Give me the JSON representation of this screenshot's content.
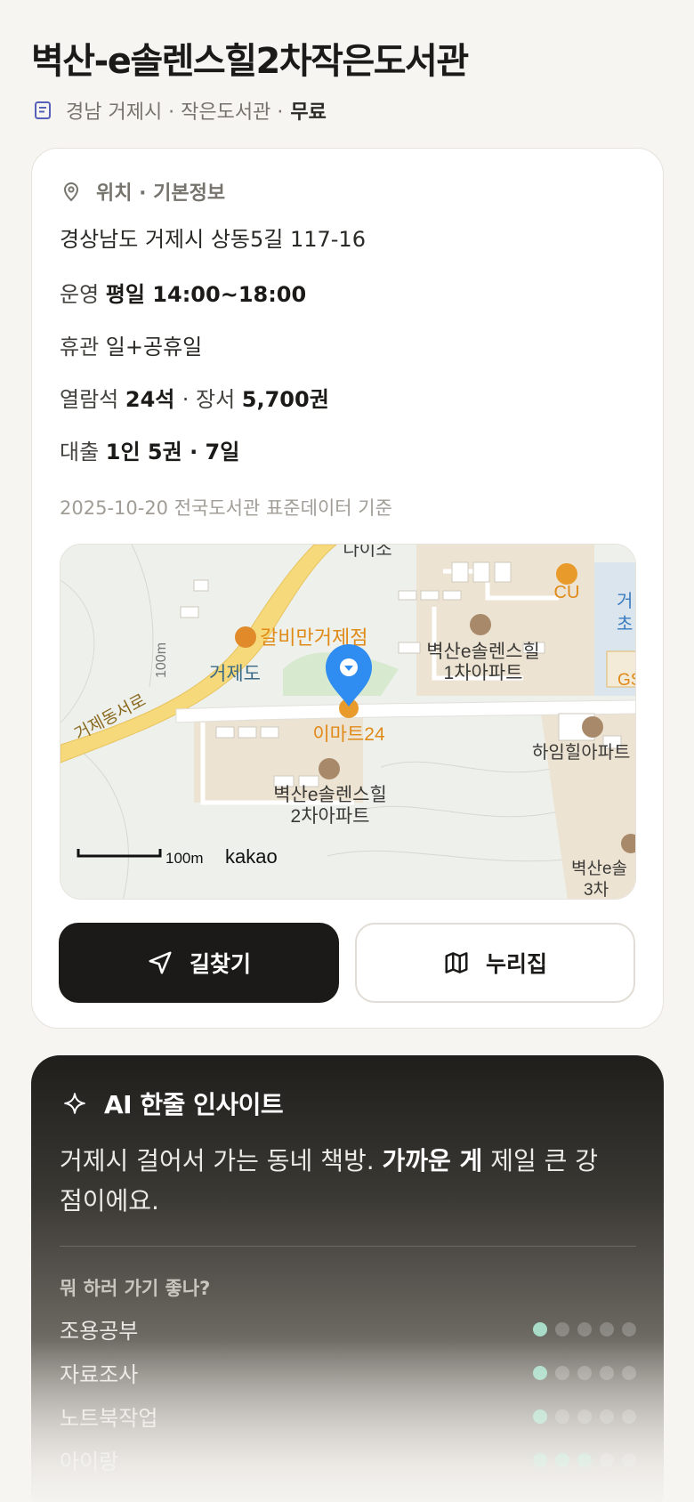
{
  "header": {
    "title": "벽산-e솔렌스힐2차작은도서관",
    "meta_prefix": "경남 거제시 · 작은도서관 ·",
    "meta_fee": "무료"
  },
  "info": {
    "section_title": "위치 · 기본정보",
    "address": "경상남도 거제시 상동5길 117-16",
    "hours_label": "운영",
    "hours_value": "평일 14:00~18:00",
    "closed_label": "휴관",
    "closed_value": "일+공휴일",
    "seats_label": "열람석",
    "seats_value": "24석",
    "sep": "·",
    "books_label": "장서",
    "books_value": "5,700권",
    "loan_label": "대출",
    "loan_value": "1인 5권 · 7일",
    "source_note": "2025-10-20 전국도서관 표준데이터 기준"
  },
  "map": {
    "labels": {
      "daiso": "다이소",
      "cu": "CU",
      "geo_top": "거",
      "cho": "초",
      "gs": "GS",
      "galbi": "갈비만거제점",
      "apt1_a": "벽산e솔렌스힐",
      "apt1_b": "1차아파트",
      "geojedo": "거제도",
      "road": "거제동서로",
      "contour": "100m",
      "emart": "이마트24",
      "haimhill": "하임힐아파트",
      "apt2_a": "벽산e솔렌스힐",
      "apt2_b": "2차아파트",
      "apt3_a": "벽산e솔",
      "apt3_b": "3차",
      "scale": "100m",
      "brand": "kakao"
    }
  },
  "buttons": {
    "directions": "길찾기",
    "nurizip": "누리집"
  },
  "ai": {
    "title": "AI 한줄 인사이트",
    "text_pre": "거제시 걸어서 가는 동네 책방. ",
    "text_bold": "가까운 게",
    "text_post": " 제일 큰 강점이에요.",
    "question": "뭐 하러 가기 좋나?",
    "activities": [
      {
        "name": "조용공부",
        "score": 1
      },
      {
        "name": "자료조사",
        "score": 1
      },
      {
        "name": "노트북작업",
        "score": 1
      },
      {
        "name": "아이랑",
        "score": 3
      }
    ],
    "max_score": 5,
    "accent_color": "#a8dcc8"
  }
}
